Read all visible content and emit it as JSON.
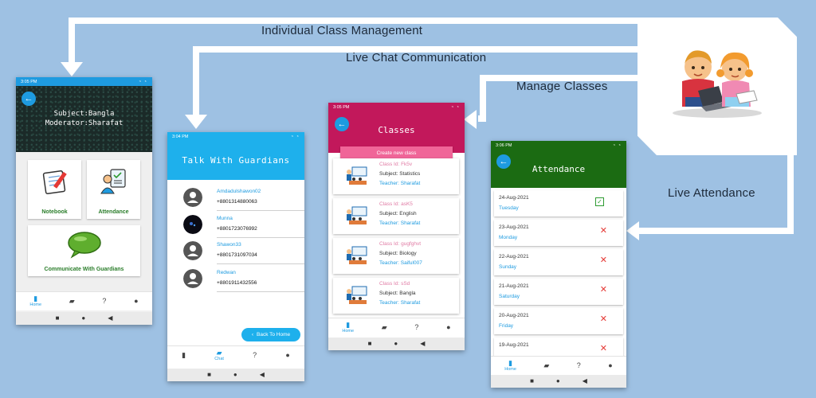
{
  "flow": {
    "label_individual": "Individual Class Management",
    "label_chat": "Live Chat Communication",
    "label_manage": "Manage Classes",
    "label_attendance": "Live Attendance"
  },
  "colors": {
    "background": "#9ec1e3",
    "accent_blue": "#1e9be0",
    "classes_header": "#c2185b",
    "attendance_header": "#1b6b12",
    "tile_green": "#2a7d2a",
    "absent_red": "#e53935",
    "present_green": "#2e9b32"
  },
  "phone1": {
    "time": "3:05 PM",
    "status_icons": "◔ ◔",
    "subject_line": "Subject:Bangla",
    "moderator_line": "Moderator:Sharafat",
    "tiles": [
      {
        "label": "Notebook",
        "icon": "notebook-icon"
      },
      {
        "label": "Attendance",
        "icon": "attendance-icon"
      },
      {
        "label": "Communicate With Guardians",
        "icon": "chat-bubble-icon"
      }
    ],
    "nav": [
      {
        "label": "Home",
        "icon": "home-icon"
      },
      {
        "label": "",
        "icon": "chat-icon"
      },
      {
        "label": "",
        "icon": "help-icon"
      },
      {
        "label": "",
        "icon": "person-icon"
      }
    ]
  },
  "phone2": {
    "time": "3:04 PM",
    "title": "Talk With Guardians",
    "contacts": [
      {
        "name": "Amdadulshawon02",
        "phone": "+8801314880063"
      },
      {
        "name": "Munna",
        "phone": "+8801723076992"
      },
      {
        "name": "Shawon33",
        "phone": "+8801731097034"
      },
      {
        "name": "Redwan",
        "phone": "+8801911432556"
      }
    ],
    "back_home": "Back To Home",
    "nav": [
      {
        "label": "",
        "icon": "home-icon"
      },
      {
        "label": "Chat",
        "icon": "chat-icon"
      },
      {
        "label": "",
        "icon": "help-icon"
      },
      {
        "label": "",
        "icon": "person-icon"
      }
    ]
  },
  "phone3": {
    "time": "3:05 PM",
    "title": "Classes",
    "create_button": "Create new class",
    "classes": [
      {
        "id": "Class Id: Fk5v",
        "subject": "Subject: Statistics",
        "teacher": "Teacher: Sharafat"
      },
      {
        "id": "Class Id: asK5",
        "subject": "Subject: English",
        "teacher": "Teacher: Sharafat"
      },
      {
        "id": "Class Id: gugfghvt",
        "subject": "Subject: Biology",
        "teacher": "Teacher: Saiful007"
      },
      {
        "id": "Class Id: sSd",
        "subject": "Subject: Bangla",
        "teacher": "Teacher: Sharafat"
      }
    ],
    "nav": [
      {
        "label": "Home",
        "icon": "home-icon"
      },
      {
        "label": "",
        "icon": "chat-icon"
      },
      {
        "label": "",
        "icon": "help-icon"
      },
      {
        "label": "",
        "icon": "person-icon"
      }
    ]
  },
  "phone4": {
    "time": "3:06 PM",
    "title": "Attendance",
    "records": [
      {
        "date": "24-Aug-2021",
        "day": "Tuesday",
        "status": "present"
      },
      {
        "date": "23-Aug-2021",
        "day": "Monday",
        "status": "absent"
      },
      {
        "date": "22-Aug-2021",
        "day": "Sunday",
        "status": "absent"
      },
      {
        "date": "21-Aug-2021",
        "day": "Saturday",
        "status": "absent"
      },
      {
        "date": "20-Aug-2021",
        "day": "Friday",
        "status": "absent"
      },
      {
        "date": "19-Aug-2021",
        "day": "",
        "status": "absent"
      }
    ],
    "nav": [
      {
        "label": "Home",
        "icon": "home-icon"
      },
      {
        "label": "",
        "icon": "chat-icon"
      },
      {
        "label": "",
        "icon": "help-icon"
      },
      {
        "label": "",
        "icon": "person-icon"
      }
    ]
  },
  "glyphs": {
    "back": "←",
    "sys_back": "◀",
    "sys_home": "●",
    "sys_recent": "■",
    "check": "✓",
    "cross": "✕",
    "nav_home": "▮",
    "nav_chat": "▰",
    "nav_help": "?",
    "nav_person": "●"
  }
}
